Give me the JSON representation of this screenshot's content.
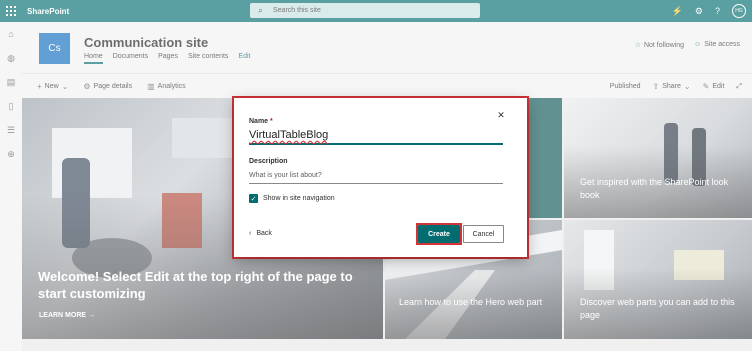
{
  "suitebar": {
    "app_name": "SharePoint",
    "search_placeholder": "Search this site",
    "avatar_initials": "HG"
  },
  "site": {
    "logo_initials": "Cs",
    "title": "Communication site",
    "nav": [
      "Home",
      "Documents",
      "Pages",
      "Site contents",
      "Edit"
    ],
    "not_following": "Not following",
    "site_access": "Site access"
  },
  "commandbar": {
    "new": "New",
    "page_details": "Page details",
    "analytics": "Analytics",
    "published": "Published",
    "share": "Share",
    "edit": "Edit"
  },
  "hero": {
    "main_title": "Welcome! Select Edit at the top right of the page to start customizing",
    "learn_more": "LEARN MORE",
    "tile_middle": "Learn how to use the Hero web part",
    "tile_right_top": "Get inspired with the SharePoint look book",
    "tile_right_bottom": "Discover web parts you can add to this page"
  },
  "dialog": {
    "name_label": "Name",
    "required_mark": "*",
    "name_value": "VirtualTableBlog",
    "description_label": "Description",
    "description_placeholder": "What is your list about?",
    "show_in_nav": "Show in site navigation",
    "back": "Back",
    "create": "Create",
    "cancel": "Cancel"
  },
  "colors": {
    "accent": "#036c70",
    "highlight": "#d13438"
  }
}
